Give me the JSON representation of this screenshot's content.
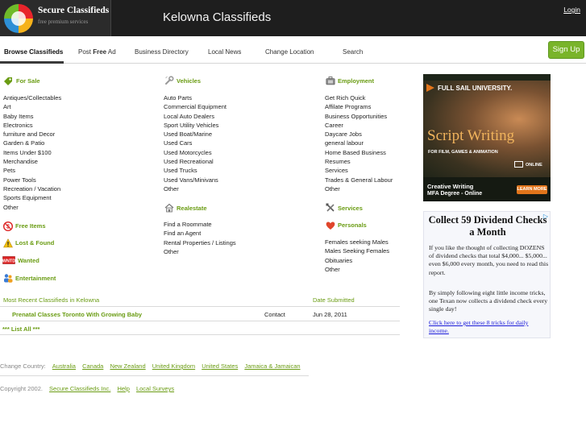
{
  "header": {
    "logo_title": "Secure Classifieds",
    "logo_tagline": "free premium services",
    "site_title": "Kelowna Classifieds",
    "login_label": "Login"
  },
  "nav": {
    "items": [
      {
        "label": "Browse Classifieds"
      },
      {
        "label": "Post Free Ad"
      },
      {
        "label": "Business Directory"
      },
      {
        "label": "Local News"
      },
      {
        "label": "Change Location"
      },
      {
        "label": "Search"
      }
    ],
    "signup_label": "Sign Up"
  },
  "categories": {
    "for_sale": {
      "title": "For Sale",
      "icon": "tag-icon",
      "items": [
        "Antiques/Collectables",
        "Art",
        "Baby Items",
        "Electronics",
        "furniture and Decor",
        "Garden & Patio",
        "Items Under $100",
        "Merchandise",
        "Pets",
        "Power Tools",
        "Recreation / Vacation",
        "Sports Equipment",
        "Other"
      ]
    },
    "vehicles": {
      "title": "Vehicles",
      "icon": "wrench-icon",
      "items": [
        "Auto Parts",
        "Commercial Equipment",
        "Local Auto Dealers",
        "Sport Utility Vehicles",
        "Used Boat/Marine",
        "Used Cars",
        "Used Motorcycles",
        "Used Recreational",
        "Used Trucks",
        "Used Vans/Minivans",
        "Other"
      ]
    },
    "employment": {
      "title": "Employment",
      "icon": "briefcase-icon",
      "items": [
        "Get Rich Quick",
        "Affilate Programs",
        "Business Opportunities",
        "Career",
        "Daycare Jobs",
        "general labour",
        "Home Based Business",
        "Resumes",
        "Services",
        "Trades & General Labour",
        "Other"
      ]
    },
    "realestate": {
      "title": "Realestate",
      "icon": "house-icon",
      "items": [
        "Find a Roommate",
        "Find an Agent",
        "Rental Properties / Listings",
        "Other"
      ]
    },
    "services": {
      "title": "Services",
      "icon": "tools-icon"
    },
    "personals": {
      "title": "Personals",
      "icon": "heart-icon",
      "items": [
        "Females seeking Males",
        "Males Seeking Females",
        "Obituaries",
        "Other"
      ]
    },
    "free_items": {
      "title": "Free Items",
      "icon": "no-dollar-icon"
    },
    "lost_found": {
      "title": "Lost & Found",
      "icon": "warning-icon"
    },
    "wanted": {
      "title": "Wanted",
      "icon": "wanted-sign-icon"
    },
    "entertainment": {
      "title": "Entertainment",
      "icon": "people-icon"
    }
  },
  "recent": {
    "heading": "Most Recent Classifieds in Kelowna",
    "date_heading": "Date Submitted",
    "rows": [
      {
        "title": "Prenatal Classes Toronto With Growing Baby",
        "contact": "Contact",
        "date": "Jun 28, 2011"
      }
    ],
    "list_all": "*** List All ***"
  },
  "footer": {
    "change_country_label": "Change Country:",
    "countries": [
      "Australia",
      "Canada",
      "New Zealand",
      "United Kingdom",
      "United States",
      "Jamaica & Jamaican"
    ],
    "copyright": "Copyright 2002.",
    "links": [
      "Secure Classifieds Inc.",
      "Help",
      "Local Surveys"
    ]
  },
  "ads": {
    "fullsail": {
      "brand": "FULL SAIL UNIVERSITY.",
      "headline": "Script Writing",
      "subline": "FOR FILM, GAMES & ANIMATION",
      "online": "ONLINE",
      "degree_line1": "Creative Writing",
      "degree_line2": "MFA Degree - Online",
      "cta": "LEARN MORE"
    },
    "dividend": {
      "title": "Collect 59 Dividend Checks a Month",
      "p1": "If you like the thought of collecting DOZENS of dividend checks that total $4,000... $5,000... even $6,000 every month, you need to read this report.",
      "p2": "By simply following eight little income tricks, one Texan now collects a dividend check every single day!",
      "link": "Click here to get these 8 tricks for daily income."
    }
  },
  "colors": {
    "accent_green": "#6a9c13",
    "signup_green": "#79b42a",
    "header_bg": "#1e1e1e"
  }
}
